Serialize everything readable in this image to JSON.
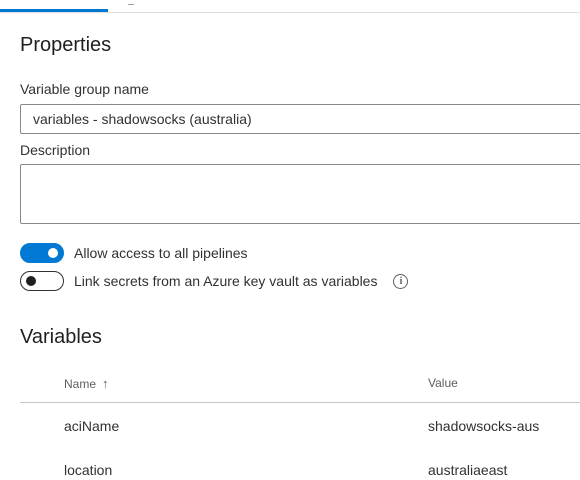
{
  "properties": {
    "title": "Properties",
    "name_label": "Variable group name",
    "name_value": "variables - shadowsocks (australia)",
    "description_label": "Description",
    "description_value": ""
  },
  "toggles": [
    {
      "label": "Allow access to all pipelines",
      "state": "on"
    },
    {
      "label": "Link secrets from an Azure key vault as variables",
      "state": "off"
    }
  ],
  "variables": {
    "title": "Variables",
    "columns": {
      "name": "Name",
      "value": "Value",
      "sort_indicator": "↑"
    },
    "rows": [
      {
        "name": "aciName",
        "value": "shadowsocks-aus"
      },
      {
        "name": "location",
        "value": "australiaeast"
      }
    ]
  },
  "colors": {
    "accent": "#0078d4",
    "border": "#8a8886"
  }
}
